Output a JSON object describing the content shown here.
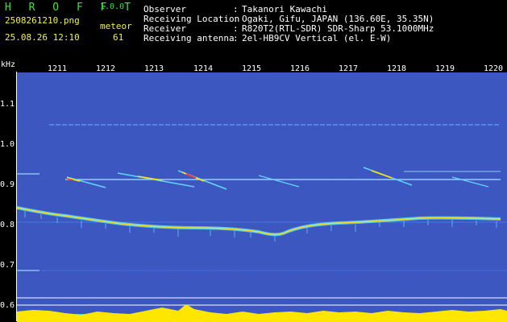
{
  "header": {
    "app_name": "H R O F F T",
    "version": "1.0.0",
    "filename": "2508261210.png",
    "detection_label": "meteor",
    "timestamp": "25.08.26 12:10",
    "meteor_count": "61",
    "observer_label": "Observer",
    "observer_value": "Takanori Kawachi",
    "location_label": "Receiving Location",
    "location_value": "Ogaki, Gifu, JAPAN (136.60E, 35.35N)",
    "receiver_label": "Receiver",
    "receiver_value": "R820T2(RTL-SDR) SDR-Sharp 53.1000MHz",
    "antenna_label": "Receiving antenna",
    "antenna_value": "2el-HB9CV Vertical (el. E-W)",
    "separator": ":"
  },
  "axis": {
    "y_unit": "kHz",
    "x_ticks": [
      "1211",
      "1212",
      "1213",
      "1214",
      "1215",
      "1216",
      "1217",
      "1218",
      "1219",
      "1220"
    ],
    "y_ticks": [
      "1.1",
      "1.0",
      "0.9",
      "0.8",
      "0.7",
      "0.6"
    ]
  },
  "colors": {
    "background": "#1b2a8a",
    "echo_cyan": "#5fd6ff",
    "echo_yellow": "#ffe600",
    "text_green": "#39e639",
    "text_yellow": "#f2f24a"
  }
}
